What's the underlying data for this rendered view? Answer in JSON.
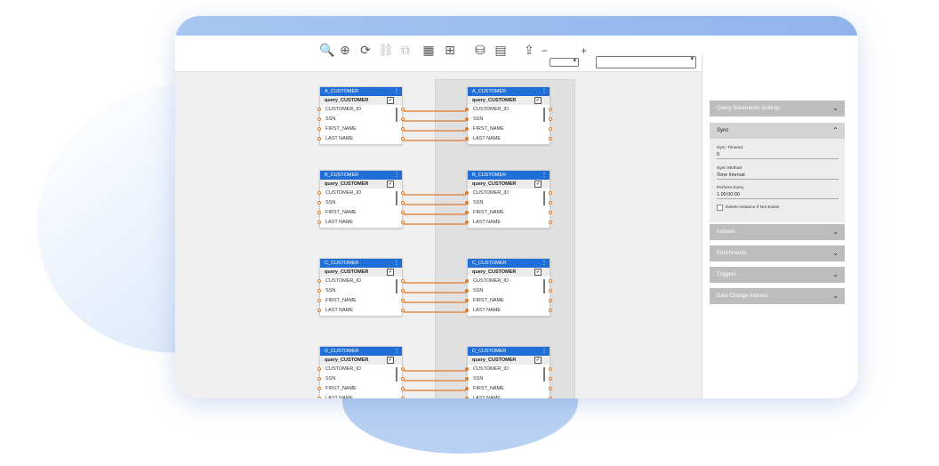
{
  "toolbar": {
    "icons": [
      {
        "name": "zoom-in-icon",
        "glyph": "🔍"
      },
      {
        "name": "add-icon",
        "glyph": "⊕"
      },
      {
        "name": "refresh-icon",
        "glyph": "⟳"
      },
      {
        "name": "link-icon",
        "glyph": "⛓"
      },
      {
        "name": "copy-icon",
        "glyph": "⧉"
      },
      {
        "name": "table-icon",
        "glyph": "▦"
      },
      {
        "name": "grid-icon",
        "glyph": "⊞"
      },
      {
        "name": "database-search-icon",
        "glyph": "⛁"
      },
      {
        "name": "table-search-icon",
        "glyph": "▤"
      },
      {
        "name": "export-icon",
        "glyph": "⇪"
      }
    ],
    "zoom_minus": "−",
    "zoom_plus": "+",
    "zoom_value": "",
    "model_value": ""
  },
  "source_tables": [
    {
      "title": "A_CUSTOMER",
      "query": "query_CUSTOMER",
      "fields": [
        "CUSTOMER_ID",
        "SSN",
        "FIRST_NAME",
        "LAST NAME"
      ]
    },
    {
      "title": "B_CUSTOMER",
      "query": "query_CUSTOMER",
      "fields": [
        "CUSTOMER_ID",
        "SSN",
        "FIRST_NAME",
        "LAST NAME"
      ]
    },
    {
      "title": "C_CUSTOMER",
      "query": "query_CUSTOMER",
      "fields": [
        "CUSTOMER_ID",
        "SSN",
        "FIRST_NAME",
        "LAST NAME"
      ]
    },
    {
      "title": "D_CUSTOMER",
      "query": "query_CUSTOMER",
      "fields": [
        "CUSTOMER_ID",
        "SSN",
        "FIRST_NAME",
        "LAST NAME"
      ]
    }
  ],
  "target_tables": [
    {
      "title": "A_CUSTOMER",
      "query": "query_CUSTOMER",
      "fields": [
        "CUSTOMER_ID",
        "SSN",
        "FIRST_NAME",
        "LAST NAME"
      ]
    },
    {
      "title": "B_CUSTOMER",
      "query": "query_CUSTOMER",
      "fields": [
        "CUSTOMER_ID",
        "SSN",
        "FIRST_NAME",
        "LAST NAME"
      ]
    },
    {
      "title": "C_CUSTOMER",
      "query": "query_CUSTOMER",
      "fields": [
        "CUSTOMER_ID",
        "SSN",
        "FIRST_NAME",
        "LAST NAME"
      ]
    },
    {
      "title": "D_CUSTOMER",
      "query": "query_CUSTOMER",
      "fields": [
        "CUSTOMER_ID",
        "SSN",
        "FIRST_NAME",
        "LAST NAME"
      ]
    }
  ],
  "checkbox_glyph": "✓",
  "menu_glyph": "⋮",
  "colors": {
    "header": "#1f6fd6",
    "wire": "#e07a2a"
  },
  "panel": {
    "sections": [
      {
        "label": "Query Statements Settings",
        "expanded": false
      },
      {
        "label": "Sync",
        "expanded": true
      },
      {
        "label": "Indexes",
        "expanded": false
      },
      {
        "label": "Enrichments",
        "expanded": false
      },
      {
        "label": "Triggers",
        "expanded": false
      },
      {
        "label": "Data Change Indexes",
        "expanded": false
      }
    ],
    "chevron_down": "⌄",
    "chevron_up": "⌃",
    "sync": {
      "timeout_label": "Sync Timeout",
      "timeout_value": "0",
      "method_label": "Sync Method",
      "method_value": "Time Interval",
      "every_label": "Perform Every",
      "every_value": "1.00:00:00",
      "delete_label": "Delete Instance If Not Exists"
    }
  }
}
